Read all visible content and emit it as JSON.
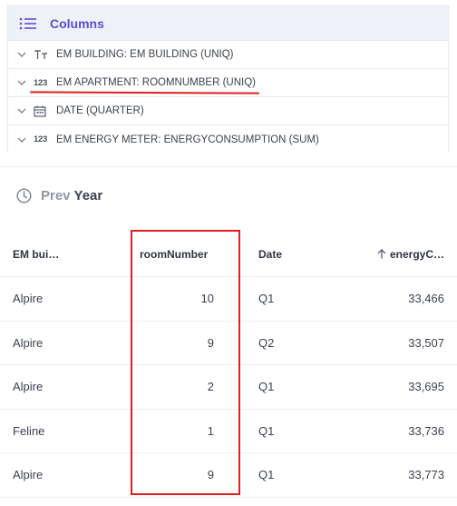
{
  "columns": {
    "title": "Columns",
    "items": [
      {
        "type_icon": "text-type-icon",
        "label": "EM BUILDING: EM BUILDING (UNIQ)"
      },
      {
        "type_icon": "number-type-icon",
        "type_text": "123",
        "label": "EM APARTMENT: ROOMNUMBER (UNIQ)"
      },
      {
        "type_icon": "calendar-type-icon",
        "label": "DATE (QUARTER)"
      },
      {
        "type_icon": "number-type-icon",
        "type_text": "123",
        "label": "EM ENERGY METER: ENERGYCONSUMPTION (SUM)"
      }
    ]
  },
  "comparison": {
    "prefix": "Prev",
    "period": "Year"
  },
  "table": {
    "headers": [
      "EM bui…",
      "roomNumber",
      "Date",
      "energyC…"
    ],
    "rows": [
      [
        "Alpire",
        "10",
        "Q1",
        "33,466"
      ],
      [
        "Alpire",
        "9",
        "Q2",
        "33,507"
      ],
      [
        "Alpire",
        "2",
        "Q1",
        "33,695"
      ],
      [
        "Feline",
        "1",
        "Q1",
        "33,736"
      ],
      [
        "Alpire",
        "9",
        "Q1",
        "33,773"
      ]
    ]
  },
  "colors": {
    "accent": "#5a4fd6",
    "annotation": "#e02020"
  }
}
